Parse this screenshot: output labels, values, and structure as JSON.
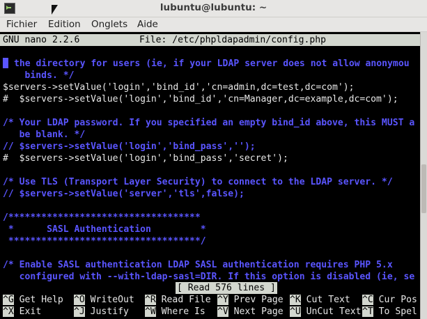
{
  "window": {
    "title": "lubuntu@lubuntu: ~"
  },
  "menu": [
    "Fichier",
    "Edition",
    "Onglets",
    "Aide"
  ],
  "nano": {
    "version": "GNU nano 2.2.6",
    "file": "File: /etc/phpldapadmin/config.php",
    "status": "[ Read 576 lines ]"
  },
  "lines": [
    {
      "text": "the directory for users (ie, if your LDAP server does not allow anonymou",
      "kind": "comment",
      "cursor": true
    },
    {
      "text": "    binds. */",
      "kind": "comment"
    },
    {
      "text": "$servers->setValue('login','bind_id','cn=admin,dc=test,dc=com');",
      "kind": "code"
    },
    {
      "text": "#  $servers->setValue('login','bind_id','cn=Manager,dc=example,dc=com');",
      "kind": "code"
    },
    {
      "text": "",
      "kind": "code"
    },
    {
      "text": "/* Your LDAP password. If you specified an empty bind_id above, this MUST a",
      "kind": "comment"
    },
    {
      "text": "   be blank. */",
      "kind": "comment"
    },
    {
      "text": "// $servers->setValue('login','bind_pass','');",
      "kind": "comment"
    },
    {
      "text": "#  $servers->setValue('login','bind_pass','secret');",
      "kind": "code"
    },
    {
      "text": "",
      "kind": "code"
    },
    {
      "text": "/* Use TLS (Transport Layer Security) to connect to the LDAP server. */",
      "kind": "comment"
    },
    {
      "text": "// $servers->setValue('server','tls',false);",
      "kind": "comment"
    },
    {
      "text": "",
      "kind": "code"
    },
    {
      "text": "/***********************************",
      "kind": "comment"
    },
    {
      "text": " *      SASL Authentication         *",
      "kind": "comment"
    },
    {
      "text": " ***********************************/",
      "kind": "comment"
    },
    {
      "text": "",
      "kind": "code"
    },
    {
      "text": "/* Enable SASL authentication LDAP SASL authentication requires PHP 5.x",
      "kind": "comment"
    },
    {
      "text": "   configured with --with-ldap-sasl=DIR. If this option is disabled (ie, se",
      "kind": "comment"
    }
  ],
  "shortcuts_row1": [
    {
      "key": "^G",
      "label": " Get Help"
    },
    {
      "key": "^O",
      "label": " WriteOut"
    },
    {
      "key": "^R",
      "label": " Read File"
    },
    {
      "key": "^Y",
      "label": " Prev Page"
    },
    {
      "key": "^K",
      "label": " Cut Text"
    },
    {
      "key": "^C",
      "label": " Cur Pos"
    }
  ],
  "shortcuts_row2": [
    {
      "key": "^X",
      "label": " Exit"
    },
    {
      "key": "^J",
      "label": " Justify"
    },
    {
      "key": "^W",
      "label": " Where Is"
    },
    {
      "key": "^V",
      "label": " Next Page"
    },
    {
      "key": "^U",
      "label": " UnCut Text"
    },
    {
      "key": "^T",
      "label": " To Spel"
    }
  ]
}
